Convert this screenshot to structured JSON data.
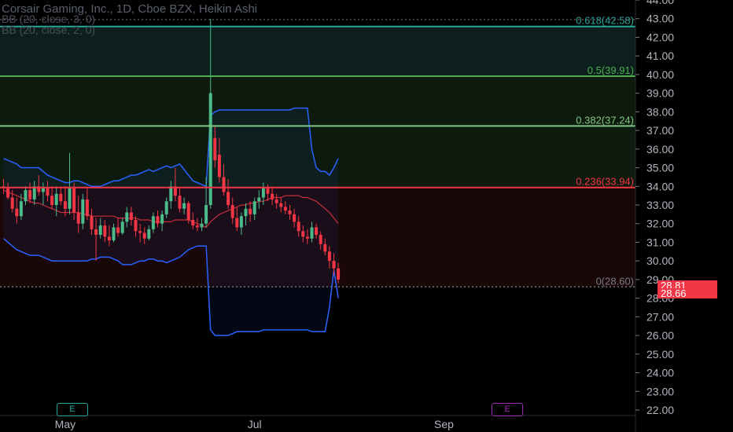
{
  "header": {
    "symbol_line": "Corsair Gaming, Inc., 1D, Cboe BZX, Heikin Ashi",
    "indicator_1": "BB (20, close, 3, 0)",
    "indicator_2": "BB (20, close, 2, 0)"
  },
  "price_tags": {
    "last": "28.81",
    "prev": "28.66"
  },
  "earnings": [
    {
      "label": "E",
      "color": "#26a69a"
    },
    {
      "label": "E",
      "color": "#9c27b0"
    }
  ],
  "colors": {
    "background": "#000000",
    "up": "#4cbb8a",
    "down": "#f23645",
    "bb": "#2962ff",
    "basis": "#f23645",
    "fib_618": "#26a69a",
    "fib_500": "#4caf50",
    "fib_382": "#81c784",
    "fib_236": "#f23645"
  },
  "chart_data": {
    "type": "candlestick",
    "y_axis": {
      "min": 22,
      "max": 44,
      "ticks": [
        "22.00",
        "23.00",
        "24.00",
        "25.00",
        "26.00",
        "27.00",
        "28.00",
        "29.00",
        "30.00",
        "31.00",
        "32.00",
        "33.00",
        "34.00",
        "35.00",
        "36.00",
        "37.00",
        "38.00",
        "39.00",
        "40.00",
        "41.00",
        "42.00",
        "43.00",
        "44.00"
      ]
    },
    "x_axis": {
      "labels": [
        {
          "text": "May",
          "bar": 14
        },
        {
          "text": "Jul",
          "bar": 57
        },
        {
          "text": "Sep",
          "bar": 100
        }
      ]
    },
    "fib_levels": [
      {
        "label": "0.618(42.58)",
        "value": 42.58,
        "color": "#26a69a"
      },
      {
        "label": "0.5(39.91)",
        "value": 39.91,
        "color": "#4caf50"
      },
      {
        "label": "0.382(37.24)",
        "value": 37.24,
        "color": "#81c784"
      },
      {
        "label": "0.236(33.94)",
        "value": 33.94,
        "color": "#f23645"
      },
      {
        "label": "0(28.60)",
        "value": 28.6,
        "color": "#787b86"
      }
    ],
    "candles": [
      [
        34.0,
        34.4,
        33.6,
        33.9
      ],
      [
        33.9,
        34.2,
        33.3,
        33.4
      ],
      [
        33.4,
        33.8,
        32.6,
        32.8
      ],
      [
        32.8,
        33.4,
        32.0,
        32.4
      ],
      [
        32.4,
        33.6,
        32.2,
        33.2
      ],
      [
        33.2,
        34.0,
        33.0,
        33.8
      ],
      [
        33.8,
        34.2,
        33.1,
        33.3
      ],
      [
        33.3,
        34.3,
        33.0,
        34.0
      ],
      [
        34.0,
        34.6,
        33.5,
        33.7
      ],
      [
        33.7,
        34.2,
        33.0,
        33.9
      ],
      [
        33.9,
        34.3,
        33.2,
        33.5
      ],
      [
        33.5,
        34.0,
        32.8,
        33.0
      ],
      [
        33.0,
        34.0,
        32.4,
        33.6
      ],
      [
        33.6,
        34.0,
        33.0,
        33.2
      ],
      [
        33.2,
        34.0,
        32.4,
        32.8
      ],
      [
        32.8,
        35.8,
        32.5,
        33.9
      ],
      [
        33.9,
        34.2,
        32.2,
        32.6
      ],
      [
        32.6,
        33.5,
        31.5,
        32.0
      ],
      [
        32.0,
        33.6,
        31.7,
        33.3
      ],
      [
        33.3,
        33.9,
        32.2,
        32.4
      ],
      [
        32.4,
        32.8,
        31.4,
        31.7
      ],
      [
        31.7,
        32.3,
        30.0,
        31.4
      ],
      [
        31.4,
        32.3,
        31.2,
        31.9
      ],
      [
        31.9,
        32.2,
        31.0,
        31.3
      ],
      [
        31.3,
        31.9,
        30.8,
        31.1
      ],
      [
        31.1,
        32.0,
        31.0,
        31.8
      ],
      [
        31.8,
        32.3,
        31.3,
        31.5
      ],
      [
        31.5,
        32.3,
        31.4,
        32.1
      ],
      [
        32.1,
        32.9,
        31.8,
        32.6
      ],
      [
        32.6,
        32.9,
        31.9,
        32.2
      ],
      [
        32.2,
        32.4,
        31.3,
        31.6
      ],
      [
        31.6,
        32.0,
        31.0,
        31.5
      ],
      [
        31.5,
        31.8,
        30.9,
        31.2
      ],
      [
        31.2,
        31.9,
        31.1,
        31.7
      ],
      [
        31.7,
        32.6,
        31.5,
        32.4
      ],
      [
        32.4,
        32.7,
        31.8,
        32.0
      ],
      [
        32.0,
        32.7,
        31.6,
        32.5
      ],
      [
        32.5,
        33.4,
        32.3,
        33.2
      ],
      [
        33.2,
        34.3,
        32.8,
        34.0
      ],
      [
        34.0,
        35.0,
        33.2,
        33.5
      ],
      [
        33.5,
        33.9,
        32.6,
        32.8
      ],
      [
        32.8,
        33.4,
        32.5,
        33.1
      ],
      [
        33.1,
        33.2,
        32.0,
        32.2
      ],
      [
        32.2,
        32.6,
        31.7,
        31.9
      ],
      [
        31.9,
        32.3,
        31.6,
        31.8
      ],
      [
        31.8,
        32.3,
        31.6,
        32.0
      ],
      [
        32.0,
        34.5,
        31.8,
        33.0
      ],
      [
        33.0,
        43.0,
        32.8,
        39.0
      ],
      [
        36.6,
        37.2,
        35.0,
        35.4
      ],
      [
        35.7,
        36.6,
        34.2,
        34.5
      ],
      [
        34.5,
        35.2,
        33.5,
        33.7
      ],
      [
        33.7,
        34.4,
        32.8,
        33.0
      ],
      [
        33.0,
        33.4,
        32.0,
        32.3
      ],
      [
        32.3,
        32.9,
        31.6,
        31.8
      ],
      [
        31.8,
        32.6,
        31.4,
        32.4
      ],
      [
        32.4,
        33.1,
        31.9,
        32.8
      ],
      [
        32.8,
        33.2,
        32.1,
        32.5
      ],
      [
        32.5,
        33.4,
        32.2,
        33.2
      ],
      [
        33.2,
        33.8,
        32.8,
        33.4
      ],
      [
        33.4,
        34.2,
        33.0,
        33.9
      ],
      [
        33.9,
        34.1,
        33.2,
        33.6
      ],
      [
        33.6,
        34.0,
        33.0,
        33.3
      ],
      [
        33.3,
        33.6,
        32.8,
        33.1
      ],
      [
        33.1,
        33.4,
        32.6,
        32.9
      ],
      [
        32.9,
        33.2,
        32.5,
        32.7
      ],
      [
        32.7,
        33.0,
        32.2,
        32.5
      ],
      [
        32.5,
        32.8,
        31.8,
        32.1
      ],
      [
        32.1,
        32.4,
        31.3,
        31.6
      ],
      [
        31.6,
        31.9,
        31.0,
        31.3
      ],
      [
        31.3,
        31.7,
        30.9,
        31.2
      ],
      [
        31.2,
        32.1,
        31.0,
        31.8
      ],
      [
        31.8,
        32.0,
        31.2,
        31.4
      ],
      [
        31.4,
        31.6,
        30.6,
        30.9
      ],
      [
        30.9,
        31.2,
        30.3,
        30.5
      ],
      [
        30.5,
        30.8,
        29.6,
        30.0
      ],
      [
        30.0,
        30.4,
        29.2,
        29.6
      ],
      [
        29.6,
        29.9,
        28.8,
        29.0
      ]
    ],
    "upper_band": [
      35.5,
      35.4,
      35.3,
      35.2,
      35.0,
      35.0,
      35.0,
      35.0,
      35.0,
      34.8,
      34.6,
      34.5,
      34.4,
      34.3,
      34.2,
      34.2,
      34.3,
      34.3,
      34.2,
      34.1,
      34.0,
      34.0,
      34.0,
      34.1,
      34.2,
      34.3,
      34.3,
      34.4,
      34.5,
      34.6,
      34.6,
      34.7,
      34.8,
      34.9,
      34.8,
      34.9,
      35.0,
      35.1,
      35.0,
      35.1,
      35.2,
      34.9,
      34.6,
      34.3,
      34.2,
      34.1,
      34.0,
      37.8,
      38.0,
      38.1,
      38.1,
      38.1,
      38.1,
      38.1,
      38.1,
      38.1,
      38.1,
      38.1,
      38.1,
      38.1,
      38.1,
      38.1,
      38.1,
      38.1,
      38.1,
      38.1,
      38.2,
      38.2,
      38.2,
      38.2,
      36.0,
      35.0,
      34.8,
      34.8,
      34.6,
      35.0,
      35.5
    ],
    "basis": [
      33.8,
      33.7,
      33.6,
      33.5,
      33.4,
      33.3,
      33.2,
      33.1,
      33.1,
      33.0,
      32.9,
      32.8,
      32.7,
      32.6,
      32.6,
      32.6,
      32.6,
      32.6,
      32.5,
      32.5,
      32.4,
      32.4,
      32.4,
      32.4,
      32.4,
      32.4,
      32.3,
      32.3,
      32.3,
      32.3,
      32.3,
      32.2,
      32.2,
      32.2,
      32.1,
      32.1,
      32.1,
      32.1,
      32.1,
      32.2,
      32.2,
      32.2,
      32.2,
      32.1,
      32.0,
      31.9,
      31.8,
      32.1,
      32.3,
      32.5,
      32.6,
      32.7,
      32.8,
      32.9,
      33.0,
      33.0,
      33.1,
      33.1,
      33.2,
      33.2,
      33.3,
      33.4,
      33.4,
      33.4,
      33.5,
      33.5,
      33.5,
      33.5,
      33.4,
      33.4,
      33.3,
      33.2,
      33.0,
      32.8,
      32.6,
      32.3,
      32.0
    ],
    "lower_band": [
      31.2,
      31.0,
      30.8,
      30.6,
      30.5,
      30.4,
      30.3,
      30.3,
      30.3,
      30.2,
      30.1,
      30.0,
      30.0,
      30.0,
      30.0,
      30.0,
      30.0,
      30.0,
      30.0,
      30.0,
      30.1,
      30.1,
      30.2,
      30.2,
      30.2,
      30.1,
      30.0,
      29.8,
      29.8,
      29.8,
      29.9,
      30.0,
      30.0,
      30.1,
      30.1,
      30.0,
      30.0,
      29.9,
      30.0,
      30.1,
      30.2,
      30.4,
      30.6,
      30.7,
      30.8,
      30.8,
      30.8,
      26.3,
      26.0,
      26.0,
      26.0,
      26.0,
      26.1,
      26.2,
      26.2,
      26.2,
      26.2,
      26.2,
      26.2,
      26.3,
      26.3,
      26.3,
      26.3,
      26.3,
      26.3,
      26.3,
      26.3,
      26.3,
      26.3,
      26.3,
      26.2,
      26.2,
      26.2,
      26.2,
      27.5,
      29.5,
      28.0
    ]
  }
}
